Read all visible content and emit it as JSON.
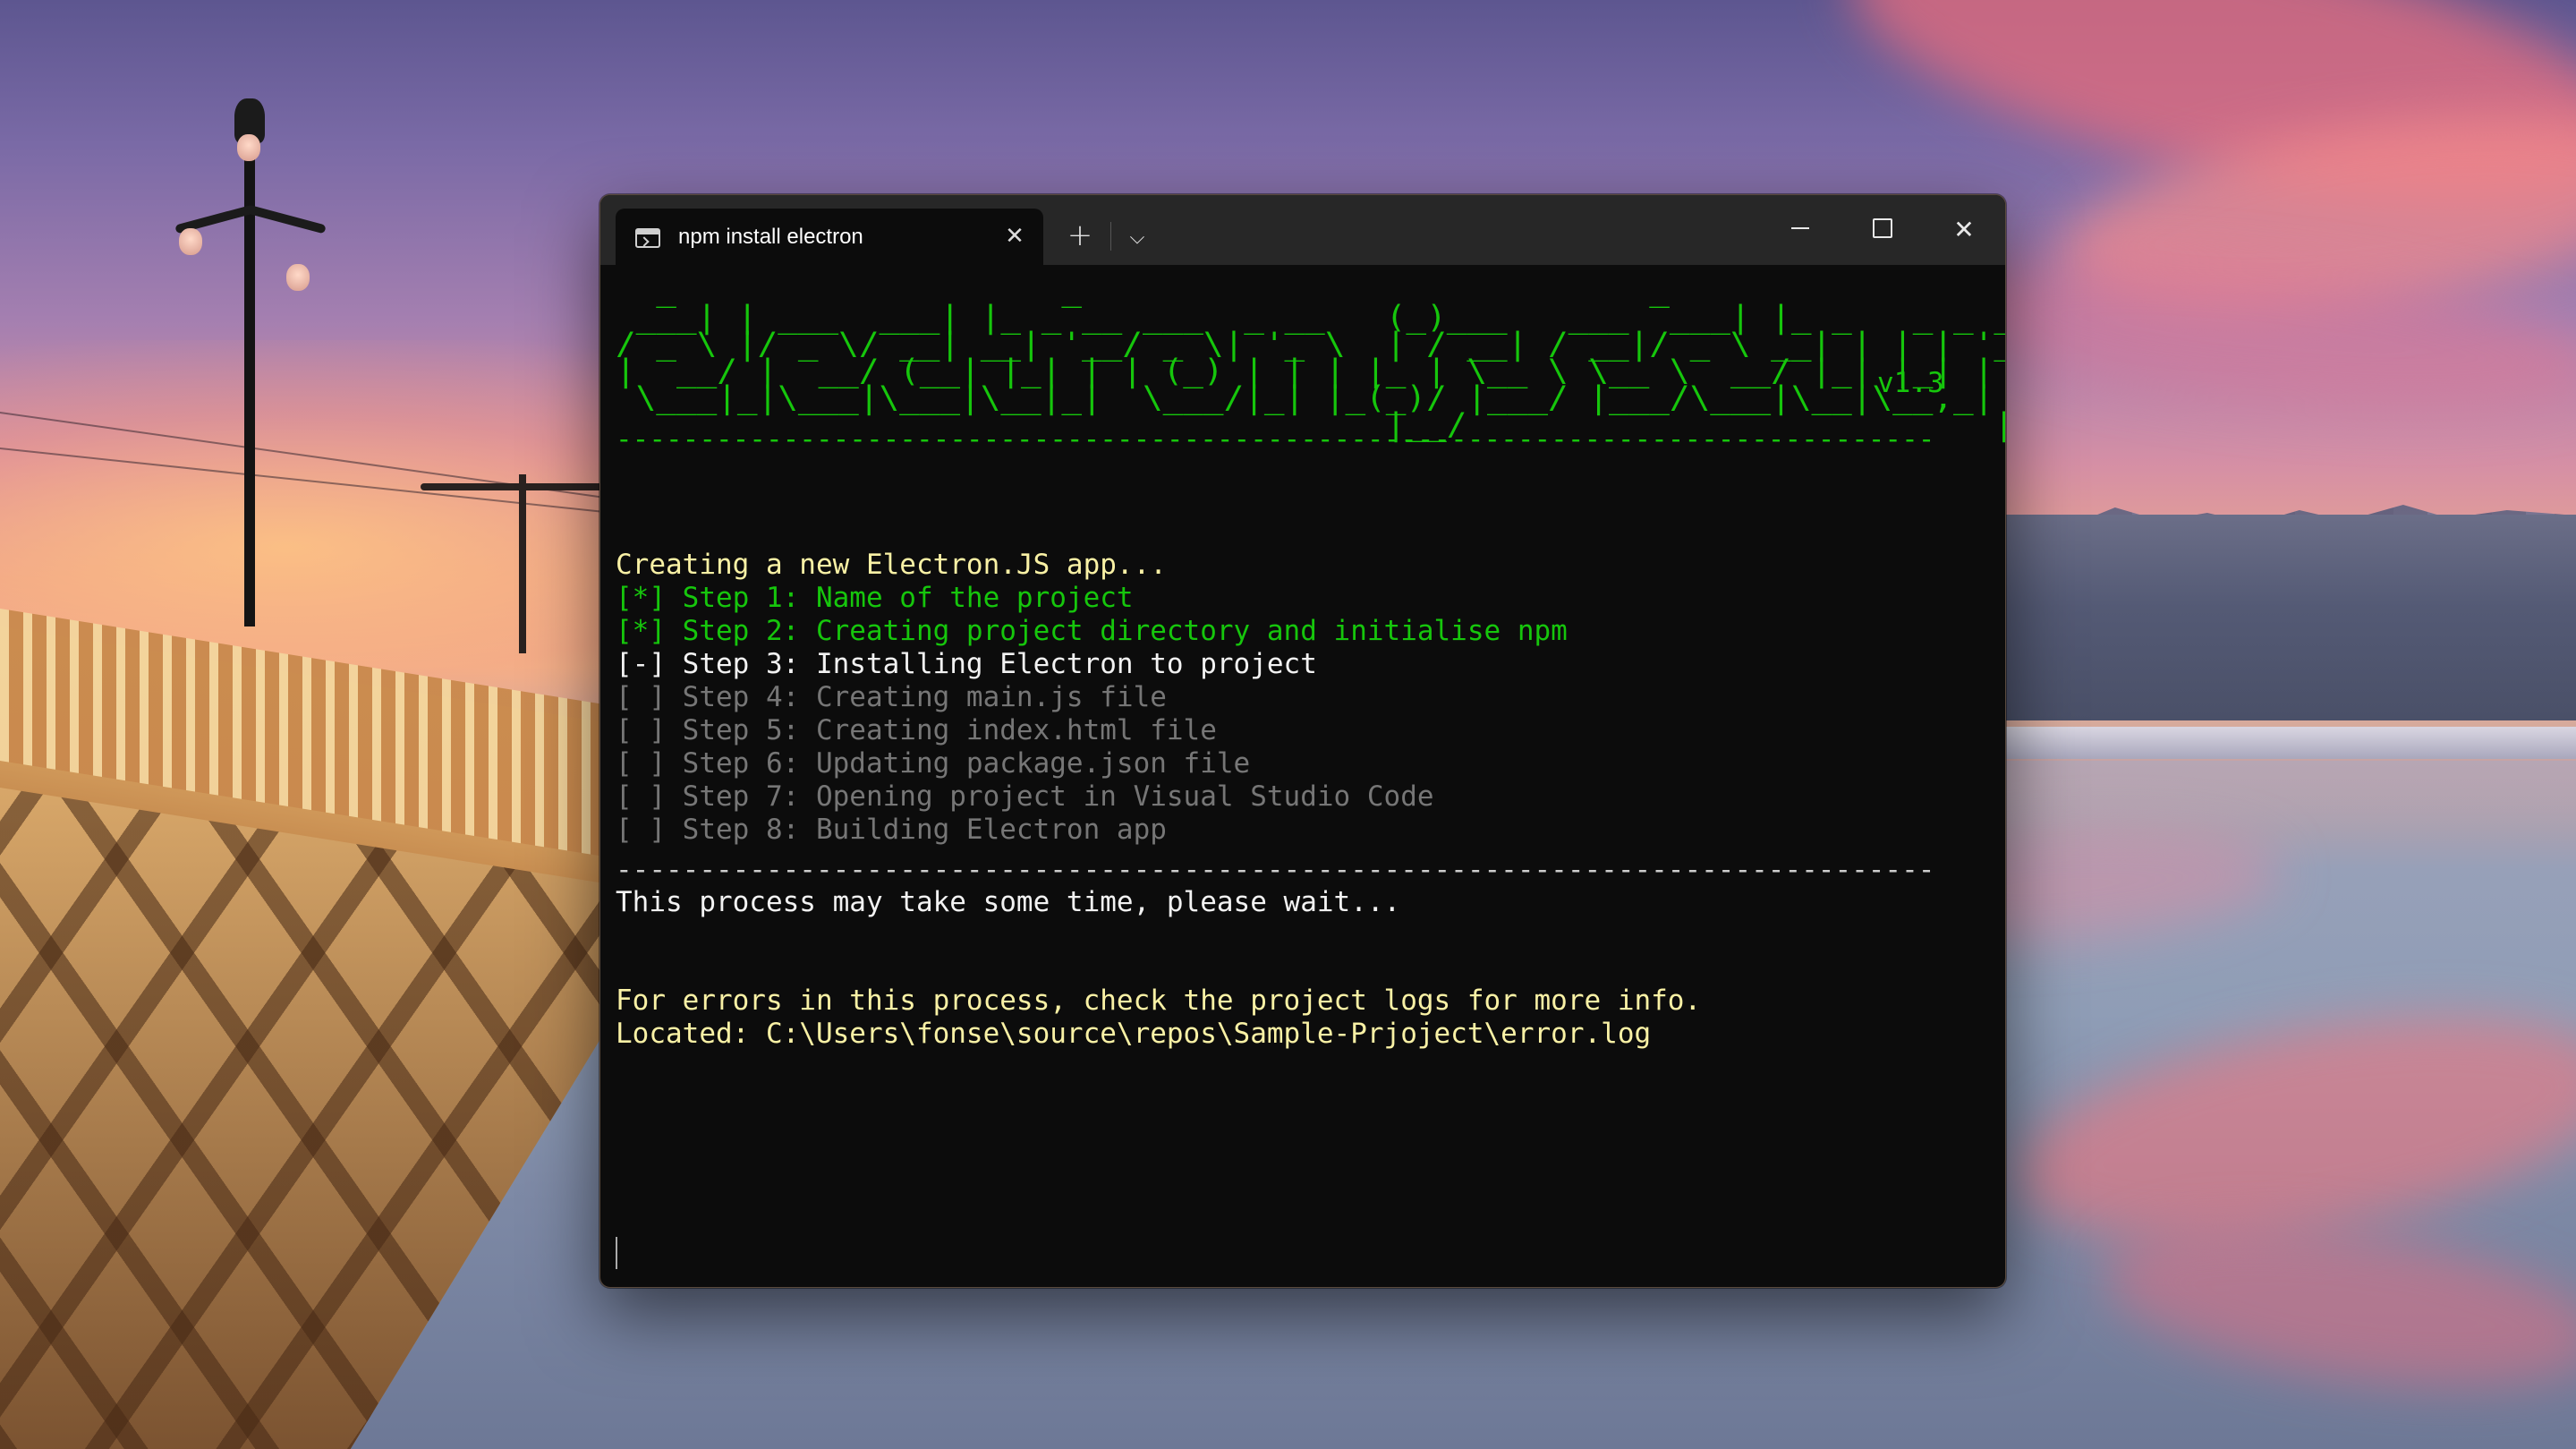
{
  "window": {
    "tab_title": "npm install electron",
    "tab_close": "✕",
    "new_tab": "+",
    "dropdown": "⌵",
    "close": "✕"
  },
  "terminal": {
    "banner": "  _                   _                            _                   _\n ___| | ___  ___| |_ _ __ ___  _ __   (_)___   ___  ___| |_ _   _ _ __\n/ _ \\ |/ _ \\/ __| __| '__/ _ \\| '_ \\  | / __| / __|/ _ \\ __| | | | '_ \\\n|  __/ |  __/ (__| |_| | | (_) | | | |_ | \\__ \\ \\__ \\  __/ |_| |_| | |_) |\n \\___|_|\\___|\\___|\\__|_|  \\___/|_| |_(_)/ |___/ |___/\\___|\\__|\\__,_| .__/\n                                      |__/                          |_|",
    "version": "v1.3",
    "rule": "-------------------------------------------------------------------------------",
    "creating": "Creating a new Electron.JS app...",
    "steps": [
      {
        "text": "[*] Step 1: Name of the project",
        "status": "done"
      },
      {
        "text": "[*] Step 2: Creating project directory and initialise npm",
        "status": "done"
      },
      {
        "text": "[-] Step 3: Installing Electron to project",
        "status": "active"
      },
      {
        "text": "[ ] Step 4: Creating main.js file",
        "status": "pending"
      },
      {
        "text": "[ ] Step 5: Creating index.html file",
        "status": "pending"
      },
      {
        "text": "[ ] Step 6: Updating package.json file",
        "status": "pending"
      },
      {
        "text": "[ ] Step 7: Opening project in Visual Studio Code",
        "status": "pending"
      },
      {
        "text": "[ ] Step 8: Building Electron app",
        "status": "pending"
      }
    ],
    "wait": "This process may take some time, please wait...",
    "errors_note": "For errors in this process, check the project logs for more info.",
    "log_location": "Located: C:\\Users\\fonse\\source\\repos\\Sample-Prjoject\\error.log"
  },
  "colors": {
    "terminal_bg": "#0c0c0c",
    "titlebar_bg": "#272727",
    "green": "#16c60c",
    "yellow": "#f9f1a5",
    "white": "#f2f2f2",
    "gray": "#767676"
  },
  "icons": {
    "tab": "terminal-icon",
    "new_tab": "plus-icon",
    "dropdown": "chevron-down-icon",
    "minimize": "minimize-icon",
    "maximize": "maximize-icon",
    "close": "close-icon"
  }
}
